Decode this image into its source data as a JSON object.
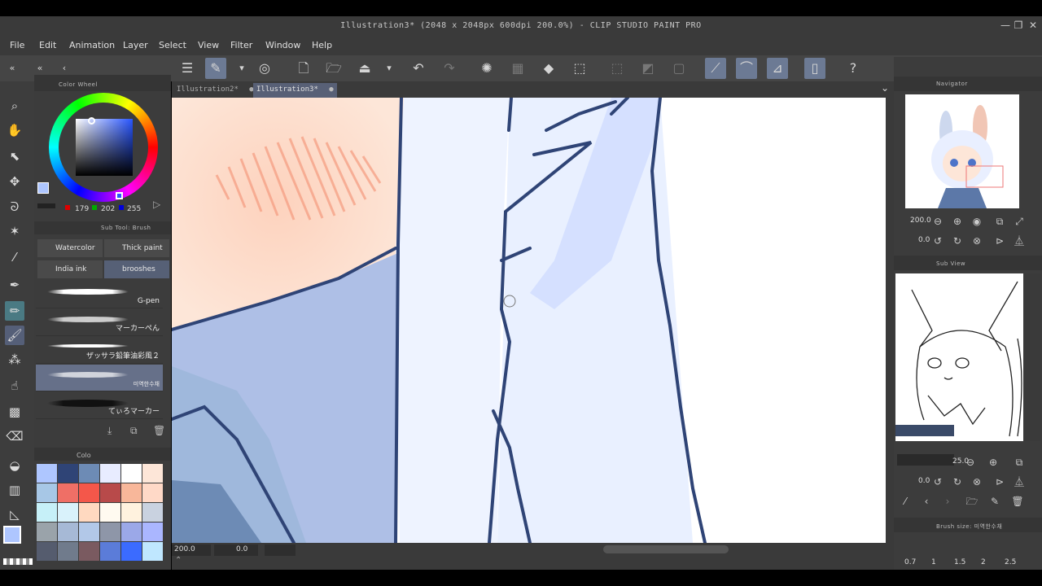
{
  "window": {
    "title": "Illustration3* (2048 x 2048px 600dpi 200.0%)  - CLIP STUDIO PAINT PRO",
    "controls": [
      "—",
      "❐",
      "✕"
    ]
  },
  "menu": [
    "File",
    "Edit",
    "Animation",
    "Layer",
    "Select",
    "View",
    "Filter",
    "Window",
    "Help"
  ],
  "tabs": [
    {
      "label": "Illustration2*",
      "close": "●"
    },
    {
      "label": "Illustration3*",
      "close": "●"
    }
  ],
  "color_wheel": {
    "title": "Color Wheel",
    "r": "179",
    "g": "202",
    "b": "255",
    "main_color": "#b3caff"
  },
  "sub_tool": {
    "title": "Sub Tool: Brush",
    "buttons": [
      "Watercolor",
      "Thick paint",
      "India ink",
      "brooshes"
    ],
    "brushes": [
      "G-pen",
      "マーカーぺん",
      "ザッサラ鉛筆油彩風２",
      "미역한수채",
      "てぃろマーカー"
    ]
  },
  "color_set": {
    "title": "Colo",
    "swatches": [
      "#aec6ff",
      "#2f4476",
      "#6d8bb5",
      "#e8ecff",
      "#ffffff",
      "#fde6d8",
      "#a7c7e6",
      "#ef6f66",
      "#f4574a",
      "#b84a4a",
      "#f8b79a",
      "#ffd9c7",
      "#c6f0f8",
      "#d9f2fb",
      "#ffd9c0",
      "#fffaf0",
      "#fff2de",
      "#c9d2e0",
      "#9aa3aa",
      "#a6b9d6",
      "#b2c8e8",
      "#8e96a8",
      "#9ba8e8",
      "#aab6ff",
      "#555c6e",
      "#707b8c",
      "#7a5a60",
      "#5b7cd9",
      "#3b6bff",
      "#bfe7ff"
    ]
  },
  "status": {
    "zoom": "200.0",
    "rotate": "0.0"
  },
  "navigator": {
    "title": "Navigator",
    "zoom": "200.0",
    "rotate": "0.0"
  },
  "sub_view": {
    "title": "Sub View",
    "zoom": "25.0",
    "rotate": "0.0"
  },
  "brush_size": {
    "title": "Brush size: 미역한수채",
    "values": [
      "0.7",
      "1",
      "1.5",
      "2",
      "2.5"
    ]
  }
}
